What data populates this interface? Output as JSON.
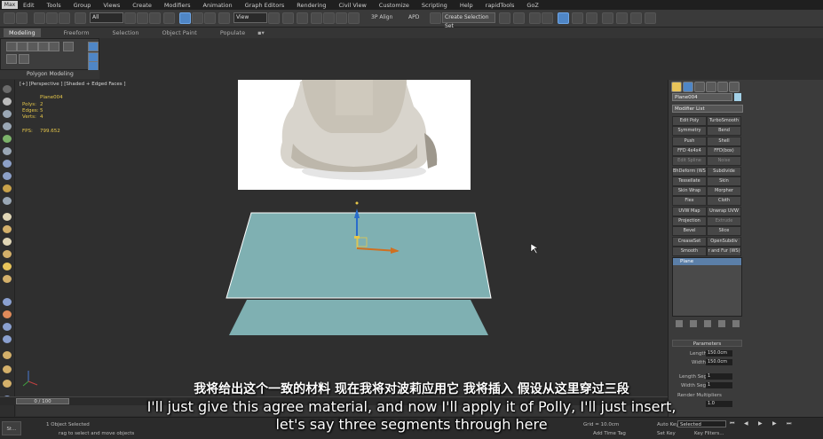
{
  "menu": {
    "logo": "Max",
    "items": [
      "Edit",
      "Tools",
      "Group",
      "Views",
      "Create",
      "Modifiers",
      "Animation",
      "Graph Editors",
      "Rendering",
      "Civil View",
      "Customize",
      "Scripting",
      "Help",
      "rapidTools",
      "GoZ"
    ]
  },
  "toolbar": {
    "selection_filter": "All",
    "ref_coord": "View",
    "align_label": "3P Align",
    "apd_label": "APD",
    "selection_set": "Create Selection Set"
  },
  "ribbon": {
    "tabs": [
      "Modeling",
      "Freeform",
      "Selection",
      "Object Paint",
      "Populate"
    ],
    "active_tab": "Modeling",
    "panel_label": "Polygon Modeling"
  },
  "viewport": {
    "label": "[+] [Perspective ] [Shaded + Edged Faces ]",
    "stats": {
      "object": "Plane004",
      "polys_label": "Polys:",
      "polys": "2",
      "edges_label": "Edges:",
      "edges": "5",
      "verts_label": "Verts:",
      "verts": "4",
      "fps_label": "FPS:",
      "fps": "799.652"
    }
  },
  "command_panel": {
    "object_name": "Plane004",
    "modifier_list": "Modifier List",
    "modifiers": [
      [
        "Edit Poly",
        "TurboSmooth"
      ],
      [
        "Symmetry",
        "Bend"
      ],
      [
        "Push",
        "Shell"
      ],
      [
        "FFD 4x4x4",
        "FFD(box)"
      ],
      [
        "Edit Spline",
        "Noise"
      ],
      [
        "BhDeform (WS)",
        "Subdivide"
      ],
      [
        "Tessellate",
        "Skin"
      ],
      [
        "Skin Wrap",
        "Morpher"
      ],
      [
        "Flex",
        "Cloth"
      ],
      [
        "UVW Map",
        "Unwrap UVW"
      ],
      [
        "Projection",
        "Extrude"
      ],
      [
        "Bevel",
        "Slice"
      ],
      [
        "CreaseSet",
        "OpenSubdiv"
      ],
      [
        "Smooth",
        "r and Fur (WS)"
      ]
    ],
    "stack_item": "Plane",
    "parameters_title": "Parameters",
    "length_label": "Length:",
    "length_value": "150.0cm",
    "width_label": "Width:",
    "width_value": "150.0cm",
    "length_segs_label": "Length Segs:",
    "length_segs": "1",
    "width_segs_label": "Width Segs:",
    "width_segs": "1",
    "render_mult_label": "Render Multipliers",
    "scale_value": "1.0"
  },
  "timeline": {
    "frame": "0 / 100"
  },
  "status": {
    "taskbar": "St...",
    "selected": "1 Object Selected",
    "prompt": "rag to select and move objects",
    "grid": "Grid = 10.0cm",
    "add_time_tag": "Add Time Tag",
    "autokey": "Auto Key",
    "set_key": "Set Key",
    "selected_dropdown": "Selected",
    "key_filters": "Key Filters..."
  },
  "subtitles": {
    "chinese": "我将给出这个一致的材料 现在我将对波莉应用它 我将插入 假设从这里穿过三段",
    "english_line1": "I'll just give this agree material, and now I'll apply it of Polly, I'll just insert,",
    "english_line2": "let's say three segments through here"
  },
  "colors": {
    "plane": "#7fb0b2",
    "viewport_bg": "#2f2f2f",
    "active_blue": "#4f86c6",
    "stats_yellow": "#e6c74a"
  }
}
